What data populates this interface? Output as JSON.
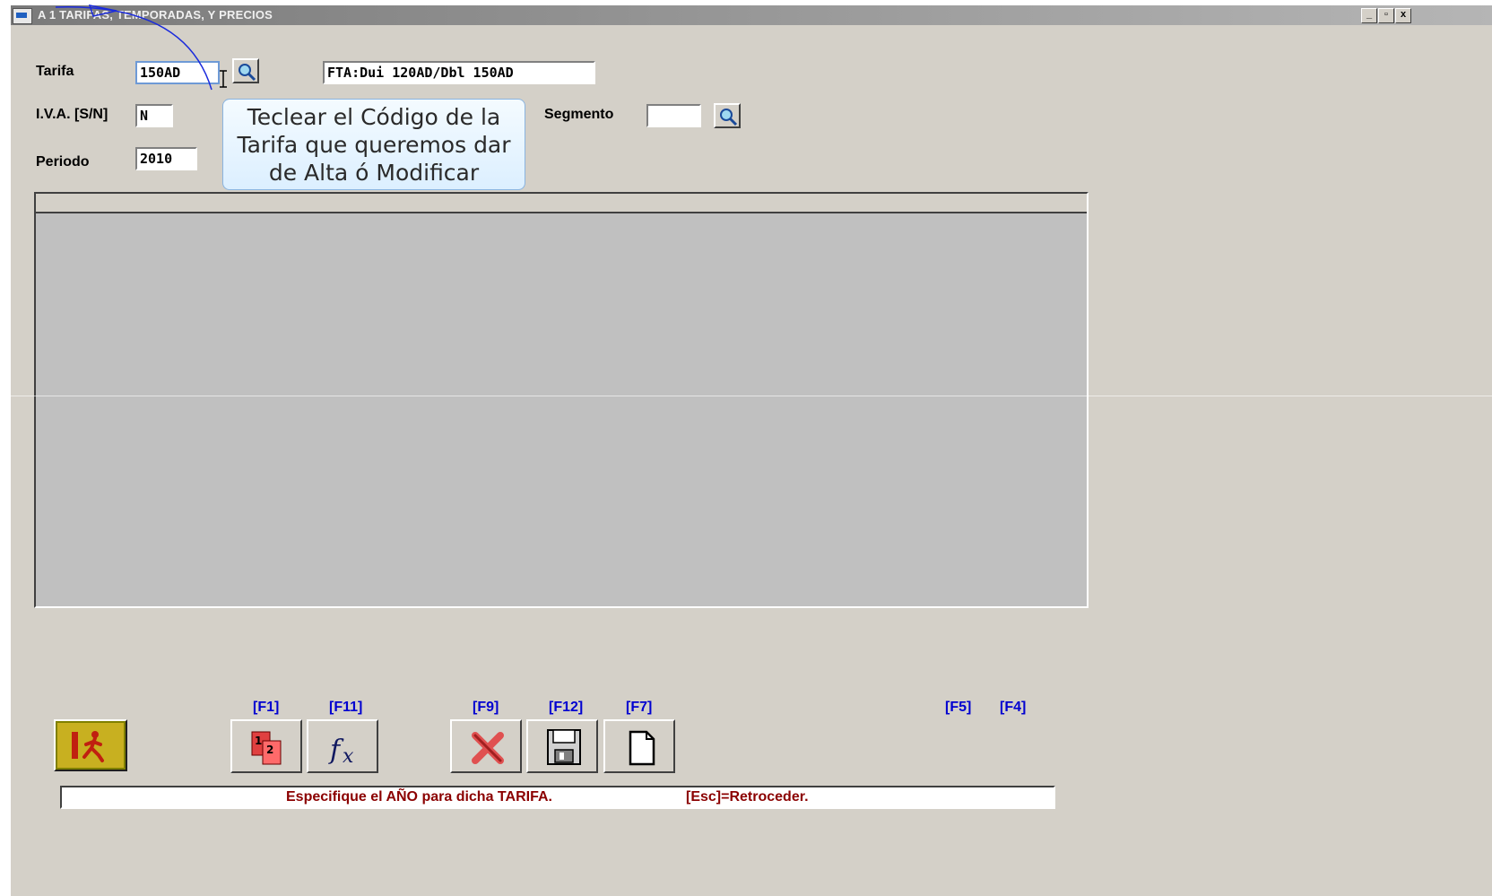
{
  "window": {
    "title": "A 1  TARIFAS, TEMPORADAS, Y PRECIOS",
    "controls": [
      "_",
      "▫",
      "x"
    ]
  },
  "form": {
    "tarifa": {
      "label": "Tarifa",
      "value": "150AD",
      "description": "FTA:Dui 120AD/Dbl 150AD"
    },
    "iva": {
      "label": "I.V.A. [S/N]",
      "value": "N"
    },
    "segmento": {
      "label": "Segmento",
      "value": ""
    },
    "periodo": {
      "label": "Periodo",
      "value": "2010"
    }
  },
  "tooltip": {
    "lines": [
      "Teclear el Código de la",
      "Tarifa que queremos dar",
      "de Alta ó Modificar"
    ]
  },
  "toolbar": {
    "keys": {
      "f1": "[F1]",
      "f11": "[F11]",
      "f9": "[F9]",
      "f12": "[F12]",
      "f7": "[F7]",
      "f5": "[F5]",
      "f4": "[F4]"
    },
    "icons": {
      "exit": "exit-runner-icon",
      "f1": "pages-1-2-icon",
      "f11": "function-fx-icon",
      "f9": "delete-x-icon",
      "f12": "floppy-save-icon",
      "f7": "new-document-icon",
      "search": "magnifier-icon"
    }
  },
  "status": {
    "message": "Especifique el AÑO para dicha TARIFA.",
    "hint": "[Esc]=Retroceder."
  },
  "colors": {
    "window_bg": "#d4d0c8",
    "grid_bg": "#c0c0c0",
    "fkey": "#0000d0",
    "status_text": "#8b0000",
    "tooltip_border": "#8ab4e0"
  }
}
